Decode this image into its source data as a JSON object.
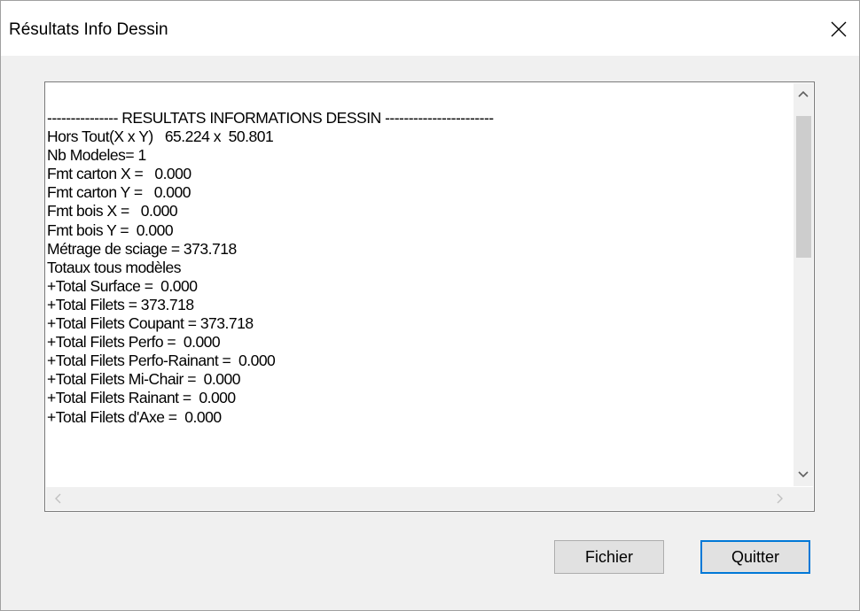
{
  "window": {
    "title": "Résultats Info Dessin"
  },
  "results": {
    "lines": [
      "--------------- RESULTATS INFORMATIONS DESSIN -----------------------",
      "Hors Tout(X x Y)   65.224 x  50.801",
      "Nb Modeles= 1",
      "Fmt carton X =   0.000",
      "Fmt carton Y =   0.000",
      "Fmt bois X =   0.000",
      "Fmt bois Y =  0.000",
      "Métrage de sciage = 373.718",
      "Totaux tous modèles",
      "+Total Surface =  0.000",
      "+Total Filets = 373.718",
      "+Total Filets Coupant = 373.718",
      "+Total Filets Perfo =  0.000",
      "+Total Filets Perfo-Rainant =  0.000",
      "+Total Filets Mi-Chair =  0.000",
      "+Total Filets Rainant =  0.000",
      "+Total Filets d'Axe =  0.000"
    ]
  },
  "buttons": {
    "file_label": "Fichier",
    "quit_label": "Quitter"
  },
  "icons": {
    "close": "close-icon",
    "scroll_up": "chevron-up-icon",
    "scroll_down": "chevron-down-icon",
    "scroll_left": "chevron-left-icon",
    "scroll_right": "chevron-right-icon"
  }
}
